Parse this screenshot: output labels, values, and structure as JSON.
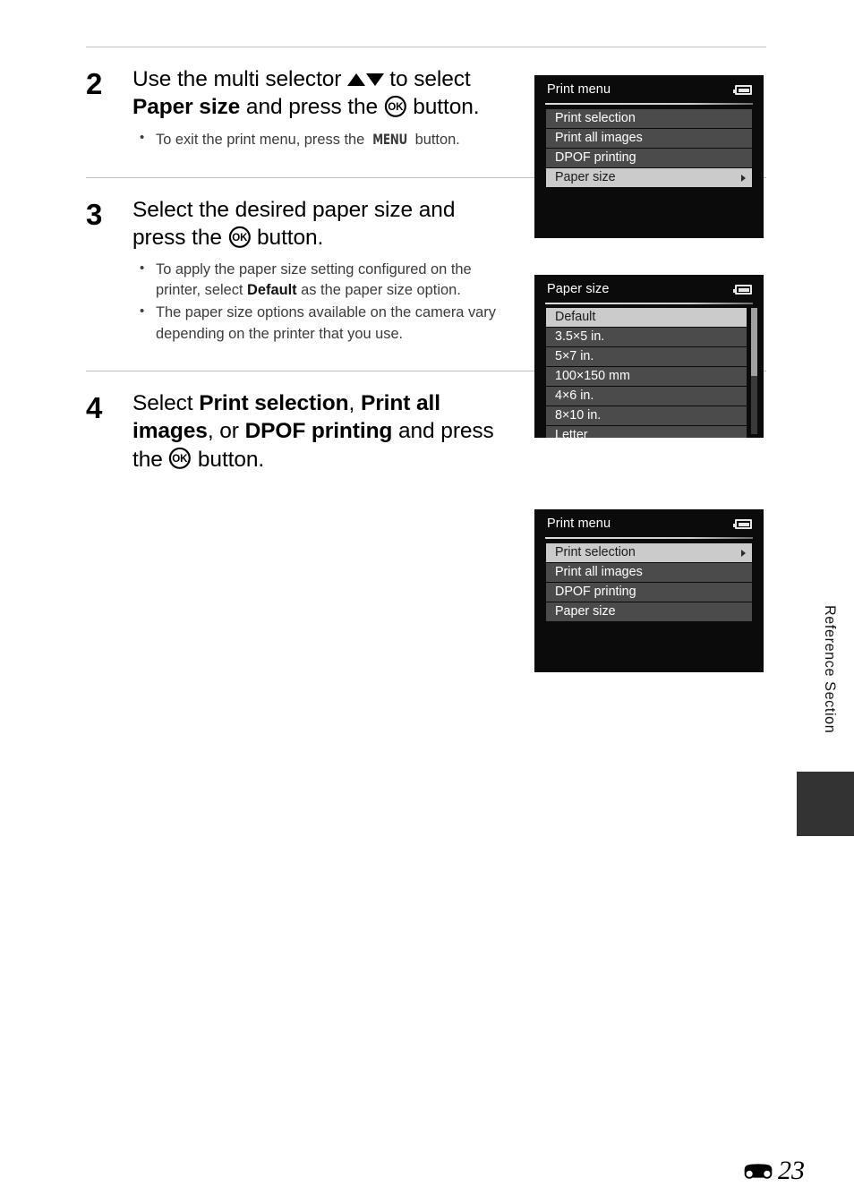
{
  "page": {
    "number": "23",
    "section_label": "Reference Section",
    "ref_mark_icon": "reference-section-icon"
  },
  "steps": [
    {
      "number": "2",
      "heading_parts": [
        {
          "text": "Use the multi selector ",
          "bold": false
        },
        {
          "text": "▲▼",
          "icon": "multi-selector-up-down-icon"
        },
        {
          "text": " to select ",
          "bold": false
        },
        {
          "text": "Paper size",
          "bold": true
        },
        {
          "text": " and press the ",
          "bold": false
        },
        {
          "text": "OK",
          "icon": "ok-button-icon"
        },
        {
          "text": " button.",
          "bold": false
        }
      ],
      "heading_plain": "Use the multi selector ▲▼ to select Paper size and press the OK button.",
      "bullets": [
        "To exit the print menu, press the MENU button."
      ]
    },
    {
      "number": "3",
      "heading_plain": "Select the desired paper size and press the OK button.",
      "bullets": [
        "To apply the paper size setting configured on the printer, select Default as the paper size option.",
        "The paper size options available on the camera vary depending on the printer that you use."
      ]
    },
    {
      "number": "4",
      "heading_plain": "Select Print selection, Print all images, or DPOF printing and press the OK button."
    }
  ],
  "step2_bullet": {
    "before": "To exit the print menu, press the ",
    "glyph": "MENU",
    "after": " button."
  },
  "step3_bullets": {
    "b1_before": "To apply the paper size setting configured on the printer, select ",
    "b1_bold": "Default",
    "b1_after": " as the paper size option.",
    "b2": "The paper size options available on the camera vary depending on the printer that you use."
  },
  "step3_heading": {
    "before": "Select the desired paper size and press the ",
    "after": " button."
  },
  "step2_heading": {
    "p1": "Use the multi selector ",
    "p2": " to select ",
    "bold1": "Paper size",
    "p3": " and press the ",
    "p4": " button."
  },
  "step4_heading": {
    "p1": "Select ",
    "bold1": "Print selection",
    "p2": ", ",
    "bold2": "Print all images",
    "p3": ", or ",
    "bold3": "DPOF printing",
    "p4": " and press the ",
    "p5": " button."
  },
  "screens": [
    {
      "id": "print-menu-paper-size-selected",
      "title": "Print menu",
      "battery_icon": "battery-icon",
      "items": [
        {
          "label": "Print selection",
          "selected": false,
          "caret": false
        },
        {
          "label": "Print all images",
          "selected": false,
          "caret": false
        },
        {
          "label": "DPOF printing",
          "selected": false,
          "caret": false
        },
        {
          "label": "Paper size",
          "selected": true,
          "caret": true
        }
      ]
    },
    {
      "id": "paper-size-menu",
      "title": "Paper size",
      "battery_icon": "battery-icon",
      "has_scrollbar": true,
      "items": [
        {
          "label": "Default",
          "selected": true,
          "caret": false
        },
        {
          "label": "3.5×5 in.",
          "selected": false,
          "caret": false
        },
        {
          "label": "5×7 in.",
          "selected": false,
          "caret": false
        },
        {
          "label": "100×150 mm",
          "selected": false,
          "caret": false
        },
        {
          "label": "4×6 in.",
          "selected": false,
          "caret": false
        },
        {
          "label": "8×10 in.",
          "selected": false,
          "caret": false
        },
        {
          "label": "Letter",
          "selected": false,
          "caret": false
        }
      ]
    },
    {
      "id": "print-menu-print-selection-selected",
      "title": "Print menu",
      "battery_icon": "battery-icon",
      "items": [
        {
          "label": "Print selection",
          "selected": true,
          "caret": true
        },
        {
          "label": "Print all images",
          "selected": false,
          "caret": false
        },
        {
          "label": "DPOF printing",
          "selected": false,
          "caret": false
        },
        {
          "label": "Paper size",
          "selected": false,
          "caret": false
        }
      ]
    }
  ],
  "colors": {
    "lcd_background": "#0b0b0b",
    "row_unselected": "#4b4b4b",
    "row_selected": "#cbcbcb",
    "rule": "#bdbdbd",
    "side_tab": "#333333"
  }
}
